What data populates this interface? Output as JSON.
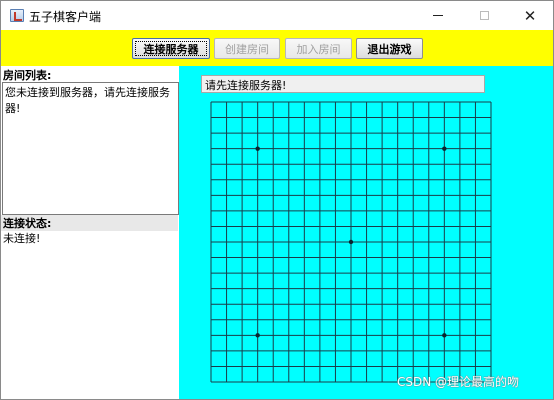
{
  "window": {
    "title": "五子棋客户端",
    "icon": "app-icon",
    "controls": {
      "minimize": "minimize-icon",
      "maximize": "maximize-icon",
      "close": "✕"
    }
  },
  "toolbar": {
    "background": "#ffff00",
    "buttons": [
      {
        "label": "连接服务器",
        "enabled": true
      },
      {
        "label": "创建房间",
        "enabled": false
      },
      {
        "label": "加入房间",
        "enabled": false
      },
      {
        "label": "退出游戏",
        "enabled": true
      }
    ]
  },
  "left_panel": {
    "room_list_label": "房间列表:",
    "room_list_text": "您未连接到服务器，请先连接服务器!",
    "status_label": "连接状态:",
    "status_text": "未连接!"
  },
  "right_panel": {
    "background": "#00ffff",
    "message": "请先连接服务器!",
    "board": {
      "lines": 19,
      "star_points": "5 points marked"
    }
  },
  "watermark": "CSDN @理论最高的吻"
}
